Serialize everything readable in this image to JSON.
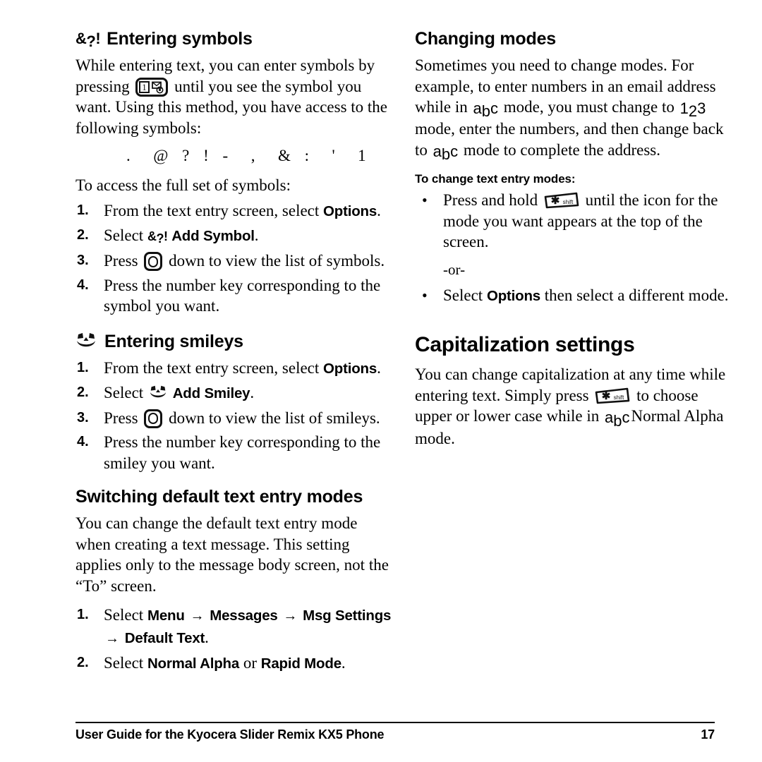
{
  "document": {
    "footer_text": "User Guide for the Kyocera Slider Remix KX5 Phone",
    "page_number": "17"
  },
  "left_column": {
    "entering_symbols": {
      "icon": "symbols-glyph-icon",
      "heading": "Entering symbols",
      "intro_part1": "While entering text, you can enter symbols by pressing",
      "intro_part2": "until you see the symbol you want. Using this method, you have access to the following symbols:",
      "symbols_list": ".  @ ? ! -  ,  & :  '  1",
      "access_lead": "To access the full set of symbols:",
      "steps": [
        {
          "number": "1.",
          "text_before": "From the text entry screen, select",
          "bold": "Options",
          "text_after": "."
        },
        {
          "number": "2.",
          "text_before": "Select",
          "bold": "Add Symbol",
          "text_after": ".",
          "icon": "symbols-glyph-icon"
        },
        {
          "number": "3.",
          "text_before": "Press",
          "text_after": "down to view the list of symbols.",
          "icon": "navigation-key-icon"
        },
        {
          "number": "4.",
          "text_before": "Press the number key corresponding to the symbol you want.",
          "text_after": ""
        }
      ]
    },
    "entering_smileys": {
      "icon": "smiley-face-icon",
      "heading": "Entering smileys",
      "steps": [
        {
          "number": "1.",
          "text_before": "From the text entry screen, select",
          "bold": "Options",
          "text_after": "."
        },
        {
          "number": "2.",
          "text_before": "Select",
          "bold": "Add Smiley",
          "text_after": ".",
          "icon": "smiley-face-icon"
        },
        {
          "number": "3.",
          "text_before": "Press",
          "text_after": "down to view the list of smileys.",
          "icon": "navigation-key-icon"
        },
        {
          "number": "4.",
          "text_before": "Press the number key corresponding to the smiley you want.",
          "text_after": ""
        }
      ]
    },
    "switching_modes": {
      "heading": "Switching default text entry modes",
      "body": "You can change the default text entry mode when creating a text message. This setting applies only to the message body screen, not the “To” screen.",
      "steps": [
        {
          "number": "1.",
          "text_before": "Select",
          "path": [
            "Menu",
            "Messages",
            "Msg Settings",
            "Default Text"
          ],
          "arrow": "→",
          "text_after": "."
        },
        {
          "number": "2.",
          "text_before": "Select",
          "bold": "Normal Alpha",
          "middle": "or",
          "bold2": "Rapid Mode",
          "text_after": "."
        }
      ]
    }
  },
  "right_column": {
    "changing_modes": {
      "heading": "Changing modes",
      "para_1": "Sometimes you need to change modes. For example, to enter numbers in an email address while in",
      "mode_abc": "abc",
      "para_2": "mode, you must change to",
      "mode_123": "123",
      "para_3": "mode, enter the numbers, and then change back to",
      "mode_abc_2": "abc",
      "para_4": "mode to complete the address.",
      "subheading": "To change text entry modes:",
      "bullets": [
        {
          "marker": "•",
          "text_before": "Press and hold",
          "icon": "shift-star-key-icon",
          "text_after": "until the icon for the mode you want appears at the top of the screen."
        },
        {
          "marker": "•",
          "text_before": "Select",
          "bold": "Options",
          "text_after": "then select a different mode."
        }
      ],
      "or_separator": "-or-"
    },
    "capitalization": {
      "heading": "Capitalization settings",
      "para_1": "You can change capitalization at any time while entering text. Simply press",
      "icon": "shift-star-key-icon",
      "para_2": "to choose upper or lower case while in",
      "mode_abc": "abc",
      "para_3": "Normal Alpha mode."
    }
  },
  "colors": {
    "text": "#000000",
    "background": "#ffffff"
  }
}
